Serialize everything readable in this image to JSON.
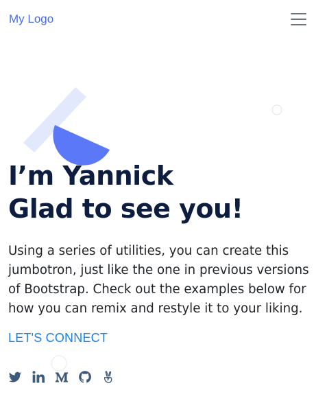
{
  "navbar": {
    "brand": "My Logo",
    "toggle_icon": "hamburger-menu-icon"
  },
  "hero": {
    "title_line1": "I’m Yannick",
    "title_line2": "Glad to see you!",
    "lead": "Using a series of utilities, you can create this jumbotron, just like the one in previous versions of Bootstrap. Check out the examples below for how you can remix and restyle it to your liking.",
    "cta_label": "LET'S CONNECT"
  },
  "social_links": [
    {
      "name": "twitter",
      "icon": "twitter-icon"
    },
    {
      "name": "linkedin",
      "icon": "linkedin-icon"
    },
    {
      "name": "medium",
      "icon": "medium-icon"
    },
    {
      "name": "github",
      "icon": "github-icon"
    },
    {
      "name": "angellist",
      "icon": "angellist-icon"
    }
  ],
  "colors": {
    "brand": "#4a6fe0",
    "title": "#0c1d40",
    "text": "#212529",
    "link": "#1a82e8",
    "icon": "#3d5a7a",
    "accent_shape": "#5a78f7",
    "stripe": "#e3e9fc"
  }
}
